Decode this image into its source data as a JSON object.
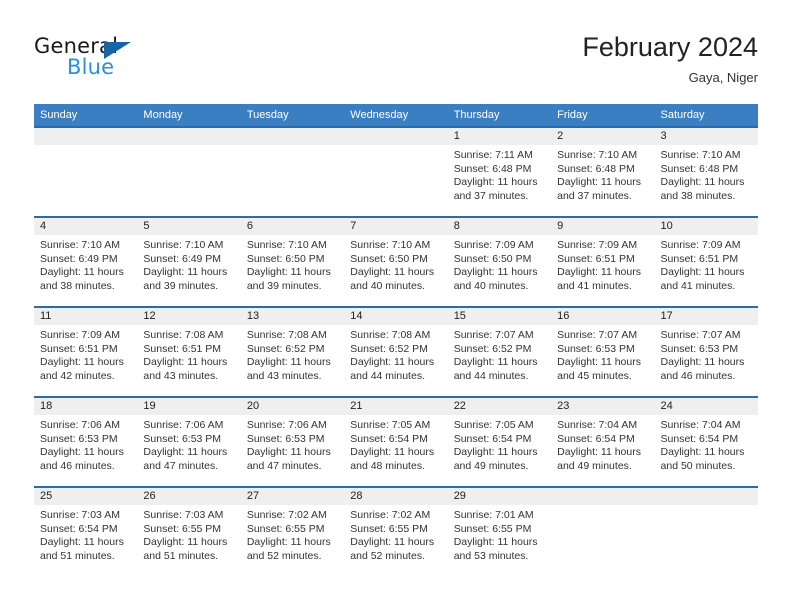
{
  "brand": {
    "name_part1": "General",
    "name_part2": "Blue",
    "triangle_color": "#1565a8",
    "blue_color": "#2f8ddb"
  },
  "header": {
    "title": "February 2024",
    "subtitle": "Gaya, Niger"
  },
  "theme": {
    "header_bg": "#3a7fc1",
    "row_rule": "#2a6ca8",
    "daynum_bg": "#efefef"
  },
  "weekdays": [
    "Sunday",
    "Monday",
    "Tuesday",
    "Wednesday",
    "Thursday",
    "Friday",
    "Saturday"
  ],
  "labels": {
    "sunrise_prefix": "Sunrise:",
    "sunset_prefix": "Sunset:",
    "daylight_prefix": "Daylight:"
  },
  "weeks": [
    [
      {
        "day": "",
        "empty": true
      },
      {
        "day": "",
        "empty": true
      },
      {
        "day": "",
        "empty": true
      },
      {
        "day": "",
        "empty": true
      },
      {
        "day": "1",
        "sunrise": "Sunrise: 7:11 AM",
        "sunset": "Sunset: 6:48 PM",
        "daylight_line1": "Daylight: 11 hours",
        "daylight_line2": "and 37 minutes."
      },
      {
        "day": "2",
        "sunrise": "Sunrise: 7:10 AM",
        "sunset": "Sunset: 6:48 PM",
        "daylight_line1": "Daylight: 11 hours",
        "daylight_line2": "and 37 minutes."
      },
      {
        "day": "3",
        "sunrise": "Sunrise: 7:10 AM",
        "sunset": "Sunset: 6:48 PM",
        "daylight_line1": "Daylight: 11 hours",
        "daylight_line2": "and 38 minutes."
      }
    ],
    [
      {
        "day": "4",
        "sunrise": "Sunrise: 7:10 AM",
        "sunset": "Sunset: 6:49 PM",
        "daylight_line1": "Daylight: 11 hours",
        "daylight_line2": "and 38 minutes."
      },
      {
        "day": "5",
        "sunrise": "Sunrise: 7:10 AM",
        "sunset": "Sunset: 6:49 PM",
        "daylight_line1": "Daylight: 11 hours",
        "daylight_line2": "and 39 minutes."
      },
      {
        "day": "6",
        "sunrise": "Sunrise: 7:10 AM",
        "sunset": "Sunset: 6:50 PM",
        "daylight_line1": "Daylight: 11 hours",
        "daylight_line2": "and 39 minutes."
      },
      {
        "day": "7",
        "sunrise": "Sunrise: 7:10 AM",
        "sunset": "Sunset: 6:50 PM",
        "daylight_line1": "Daylight: 11 hours",
        "daylight_line2": "and 40 minutes."
      },
      {
        "day": "8",
        "sunrise": "Sunrise: 7:09 AM",
        "sunset": "Sunset: 6:50 PM",
        "daylight_line1": "Daylight: 11 hours",
        "daylight_line2": "and 40 minutes."
      },
      {
        "day": "9",
        "sunrise": "Sunrise: 7:09 AM",
        "sunset": "Sunset: 6:51 PM",
        "daylight_line1": "Daylight: 11 hours",
        "daylight_line2": "and 41 minutes."
      },
      {
        "day": "10",
        "sunrise": "Sunrise: 7:09 AM",
        "sunset": "Sunset: 6:51 PM",
        "daylight_line1": "Daylight: 11 hours",
        "daylight_line2": "and 41 minutes."
      }
    ],
    [
      {
        "day": "11",
        "sunrise": "Sunrise: 7:09 AM",
        "sunset": "Sunset: 6:51 PM",
        "daylight_line1": "Daylight: 11 hours",
        "daylight_line2": "and 42 minutes."
      },
      {
        "day": "12",
        "sunrise": "Sunrise: 7:08 AM",
        "sunset": "Sunset: 6:51 PM",
        "daylight_line1": "Daylight: 11 hours",
        "daylight_line2": "and 43 minutes."
      },
      {
        "day": "13",
        "sunrise": "Sunrise: 7:08 AM",
        "sunset": "Sunset: 6:52 PM",
        "daylight_line1": "Daylight: 11 hours",
        "daylight_line2": "and 43 minutes."
      },
      {
        "day": "14",
        "sunrise": "Sunrise: 7:08 AM",
        "sunset": "Sunset: 6:52 PM",
        "daylight_line1": "Daylight: 11 hours",
        "daylight_line2": "and 44 minutes."
      },
      {
        "day": "15",
        "sunrise": "Sunrise: 7:07 AM",
        "sunset": "Sunset: 6:52 PM",
        "daylight_line1": "Daylight: 11 hours",
        "daylight_line2": "and 44 minutes."
      },
      {
        "day": "16",
        "sunrise": "Sunrise: 7:07 AM",
        "sunset": "Sunset: 6:53 PM",
        "daylight_line1": "Daylight: 11 hours",
        "daylight_line2": "and 45 minutes."
      },
      {
        "day": "17",
        "sunrise": "Sunrise: 7:07 AM",
        "sunset": "Sunset: 6:53 PM",
        "daylight_line1": "Daylight: 11 hours",
        "daylight_line2": "and 46 minutes."
      }
    ],
    [
      {
        "day": "18",
        "sunrise": "Sunrise: 7:06 AM",
        "sunset": "Sunset: 6:53 PM",
        "daylight_line1": "Daylight: 11 hours",
        "daylight_line2": "and 46 minutes."
      },
      {
        "day": "19",
        "sunrise": "Sunrise: 7:06 AM",
        "sunset": "Sunset: 6:53 PM",
        "daylight_line1": "Daylight: 11 hours",
        "daylight_line2": "and 47 minutes."
      },
      {
        "day": "20",
        "sunrise": "Sunrise: 7:06 AM",
        "sunset": "Sunset: 6:53 PM",
        "daylight_line1": "Daylight: 11 hours",
        "daylight_line2": "and 47 minutes."
      },
      {
        "day": "21",
        "sunrise": "Sunrise: 7:05 AM",
        "sunset": "Sunset: 6:54 PM",
        "daylight_line1": "Daylight: 11 hours",
        "daylight_line2": "and 48 minutes."
      },
      {
        "day": "22",
        "sunrise": "Sunrise: 7:05 AM",
        "sunset": "Sunset: 6:54 PM",
        "daylight_line1": "Daylight: 11 hours",
        "daylight_line2": "and 49 minutes."
      },
      {
        "day": "23",
        "sunrise": "Sunrise: 7:04 AM",
        "sunset": "Sunset: 6:54 PM",
        "daylight_line1": "Daylight: 11 hours",
        "daylight_line2": "and 49 minutes."
      },
      {
        "day": "24",
        "sunrise": "Sunrise: 7:04 AM",
        "sunset": "Sunset: 6:54 PM",
        "daylight_line1": "Daylight: 11 hours",
        "daylight_line2": "and 50 minutes."
      }
    ],
    [
      {
        "day": "25",
        "sunrise": "Sunrise: 7:03 AM",
        "sunset": "Sunset: 6:54 PM",
        "daylight_line1": "Daylight: 11 hours",
        "daylight_line2": "and 51 minutes."
      },
      {
        "day": "26",
        "sunrise": "Sunrise: 7:03 AM",
        "sunset": "Sunset: 6:55 PM",
        "daylight_line1": "Daylight: 11 hours",
        "daylight_line2": "and 51 minutes."
      },
      {
        "day": "27",
        "sunrise": "Sunrise: 7:02 AM",
        "sunset": "Sunset: 6:55 PM",
        "daylight_line1": "Daylight: 11 hours",
        "daylight_line2": "and 52 minutes."
      },
      {
        "day": "28",
        "sunrise": "Sunrise: 7:02 AM",
        "sunset": "Sunset: 6:55 PM",
        "daylight_line1": "Daylight: 11 hours",
        "daylight_line2": "and 52 minutes."
      },
      {
        "day": "29",
        "sunrise": "Sunrise: 7:01 AM",
        "sunset": "Sunset: 6:55 PM",
        "daylight_line1": "Daylight: 11 hours",
        "daylight_line2": "and 53 minutes."
      },
      {
        "day": "",
        "empty": true
      },
      {
        "day": "",
        "empty": true
      }
    ]
  ]
}
